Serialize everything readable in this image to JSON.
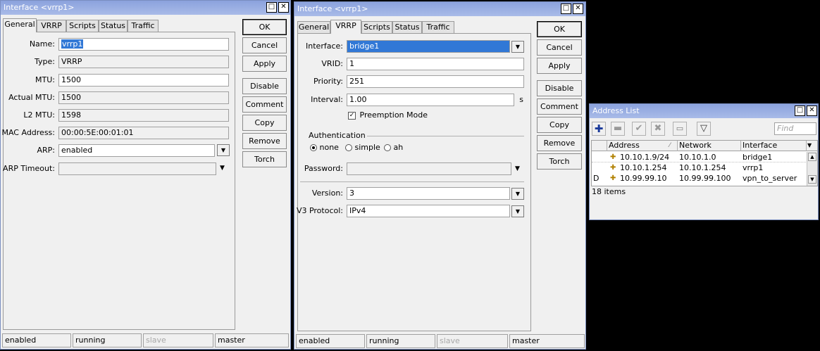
{
  "w1": {
    "title": "Interface <vrrp1>",
    "tabs": [
      "General",
      "VRRP",
      "Scripts",
      "Status",
      "Traffic"
    ],
    "fields": {
      "name_label": "Name:",
      "name": "vrrp1",
      "type_label": "Type:",
      "type": "VRRP",
      "mtu_label": "MTU:",
      "mtu": "1500",
      "actual_mtu_label": "Actual MTU:",
      "actual_mtu": "1500",
      "l2_mtu_label": "L2 MTU:",
      "l2_mtu": "1598",
      "mac_label": "MAC Address:",
      "mac": "00:00:5E:00:01:01",
      "arp_label": "ARP:",
      "arp": "enabled",
      "arp_timeout_label": "ARP Timeout:",
      "arp_timeout": ""
    },
    "buttons": [
      "OK",
      "Cancel",
      "Apply",
      "Disable",
      "Comment",
      "Copy",
      "Remove",
      "Torch"
    ],
    "status": [
      "enabled",
      "running",
      "slave",
      "master"
    ]
  },
  "w2": {
    "title": "Interface <vrrp1>",
    "tabs": [
      "General",
      "VRRP",
      "Scripts",
      "Status",
      "Traffic"
    ],
    "fields": {
      "interface_label": "Interface:",
      "interface": "bridge1",
      "vrid_label": "VRID:",
      "vrid": "1",
      "priority_label": "Priority:",
      "priority": "251",
      "interval_label": "Interval:",
      "interval": "1.00",
      "interval_unit": "s",
      "preemption_label": "Preemption Mode",
      "auth_header": "Authentication",
      "auth_none": "none",
      "auth_simple": "simple",
      "auth_ah": "ah",
      "password_label": "Password:",
      "password": "",
      "version_label": "Version:",
      "version": "3",
      "v3_label": "V3 Protocol:",
      "v3": "IPv4"
    },
    "buttons": [
      "OK",
      "Cancel",
      "Apply",
      "Disable",
      "Comment",
      "Copy",
      "Remove",
      "Torch"
    ],
    "status": [
      "enabled",
      "running",
      "slave",
      "master"
    ]
  },
  "addr": {
    "title": "Address List",
    "find_placeholder": "Find",
    "columns": [
      "Address",
      "Network",
      "Interface"
    ],
    "rows": [
      {
        "flag": "",
        "address": "10.10.1.9/24",
        "network": "10.10.1.0",
        "interface": "bridge1"
      },
      {
        "flag": "",
        "address": "10.10.1.254",
        "network": "10.10.1.254",
        "interface": "vrrp1"
      },
      {
        "flag": "D",
        "address": "10.99.99.10",
        "network": "10.99.99.100",
        "interface": "vpn_to_server"
      }
    ],
    "count": "18 items"
  },
  "colors": {
    "titlebar": "#9bb0e6",
    "selection": "#3178d6",
    "window_bg": "#f0f0f0",
    "plus_icon": "#1a3a9a"
  }
}
